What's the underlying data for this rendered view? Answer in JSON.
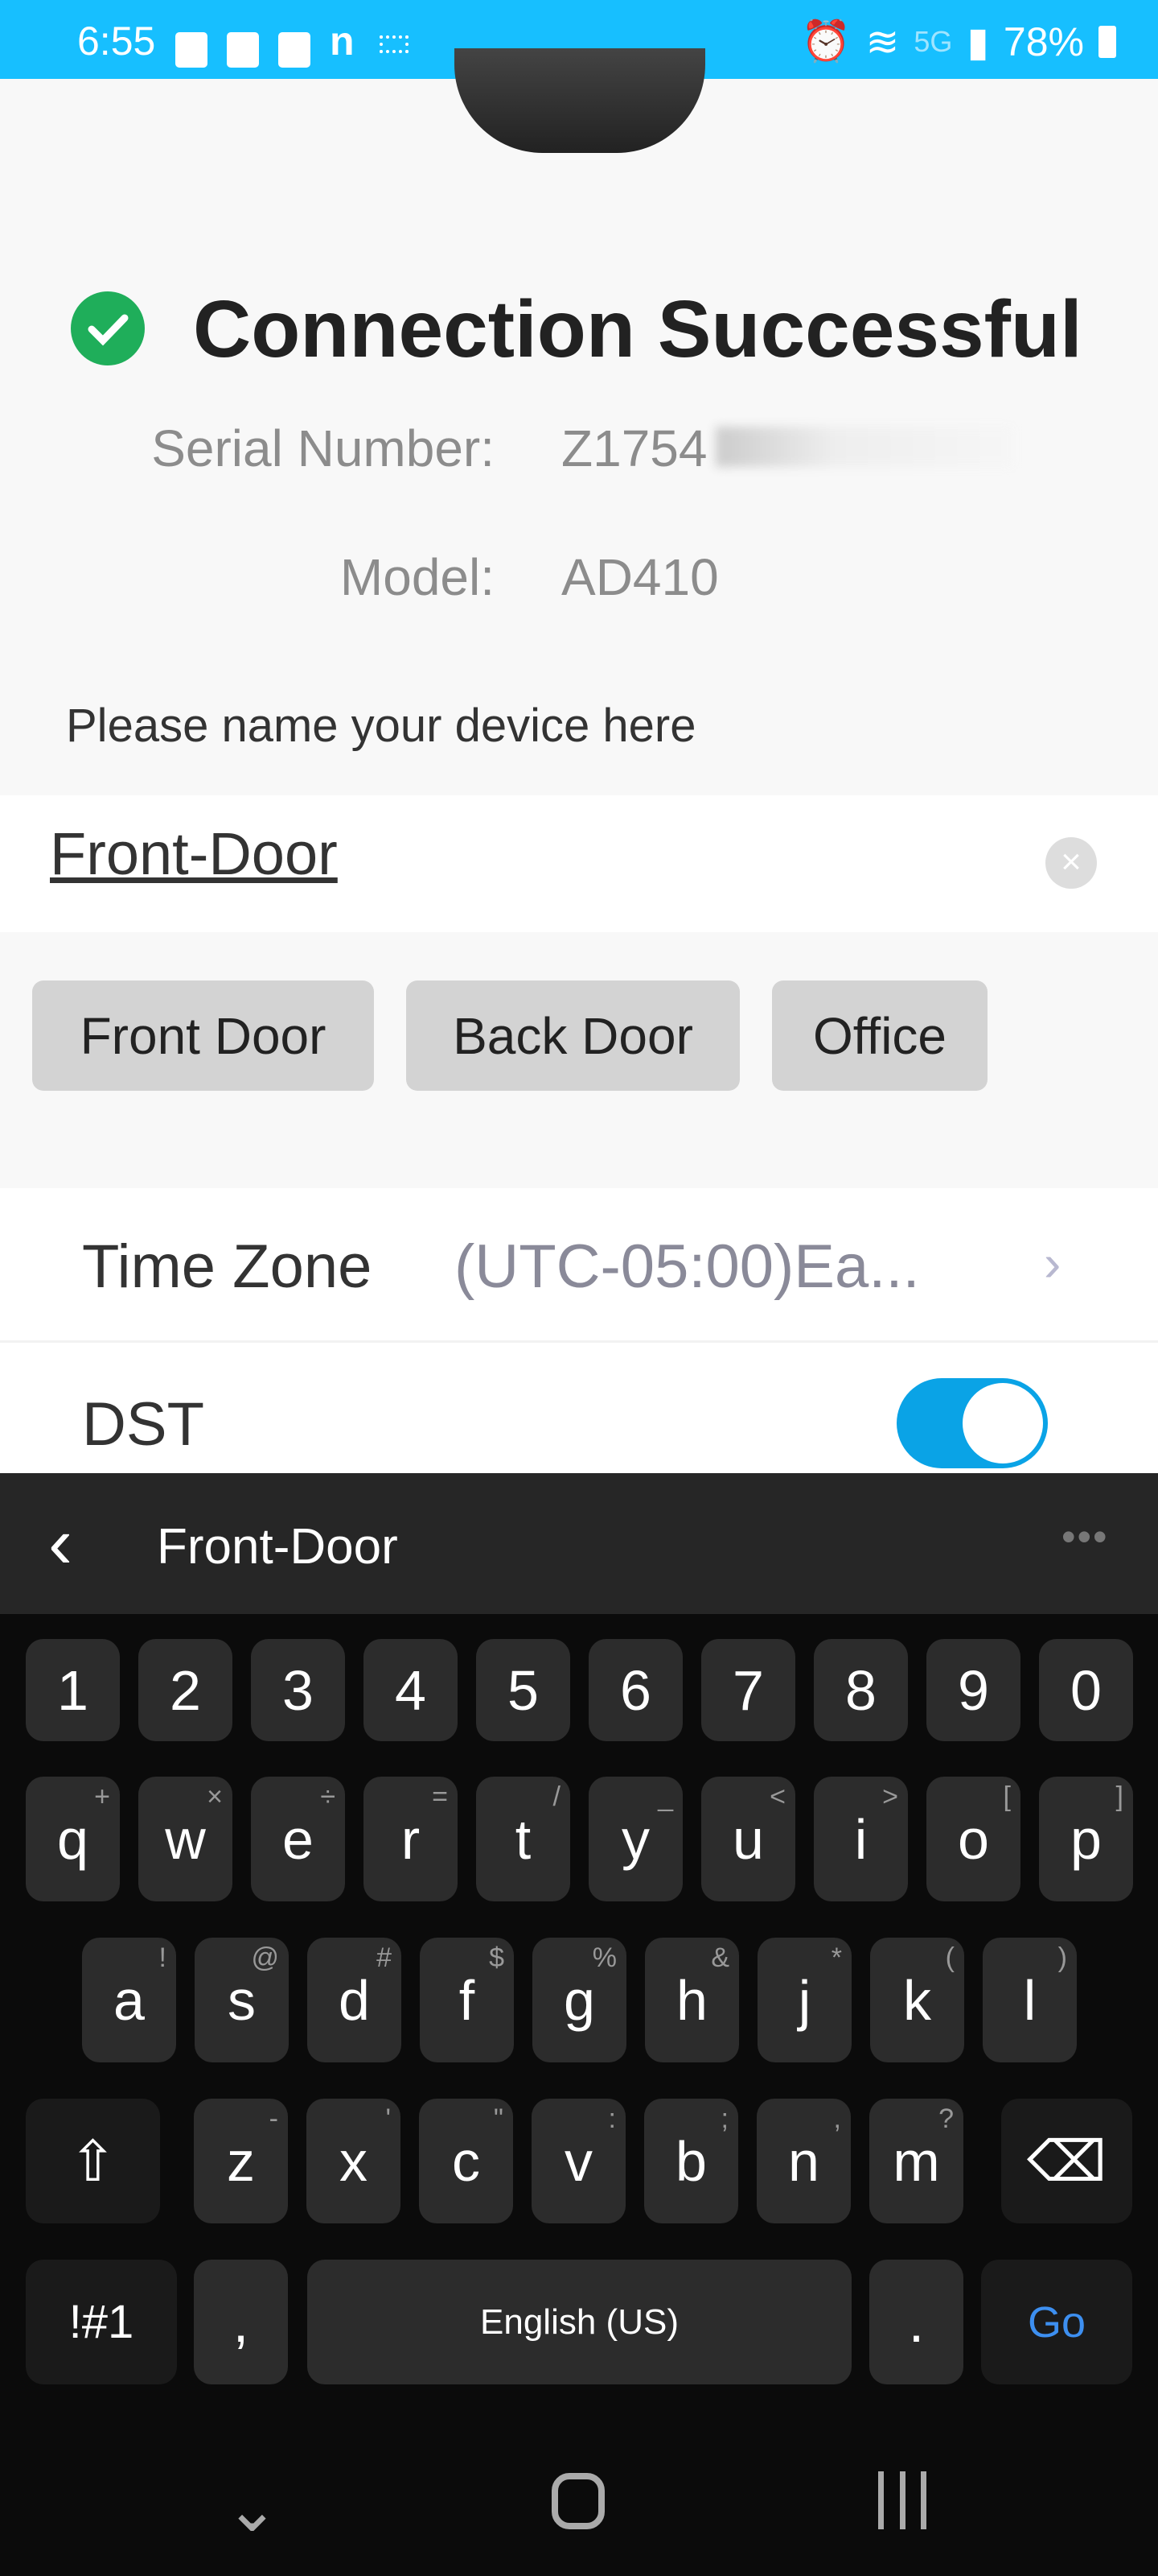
{
  "status_bar": {
    "time": "6:55",
    "network": "5G",
    "battery": "78%",
    "bg": "#17bfff"
  },
  "connection": {
    "title": "Connection Successful",
    "serial_label": "Serial Number:",
    "serial_value": "Z1754",
    "model_label": "Model:",
    "model_value": "AD410"
  },
  "naming": {
    "prompt": "Please name your device here",
    "value": "Front-Door",
    "suggestions": [
      "Front Door",
      "Back Door",
      "Office"
    ]
  },
  "settings": {
    "time_zone_label": "Time Zone",
    "time_zone_value": "(UTC-05:00)Ea...",
    "dst_label": "DST",
    "dst_on": true,
    "accent": "#0aa3e6"
  },
  "keyboard": {
    "preview": "Front-Door",
    "numbers": [
      "1",
      "2",
      "3",
      "4",
      "5",
      "6",
      "7",
      "8",
      "9",
      "0"
    ],
    "row1": [
      [
        "q",
        "+"
      ],
      [
        "w",
        "×"
      ],
      [
        "e",
        "÷"
      ],
      [
        "r",
        "="
      ],
      [
        "t",
        "/"
      ],
      [
        "y",
        "_"
      ],
      [
        "u",
        "<"
      ],
      [
        "i",
        ">"
      ],
      [
        "o",
        "["
      ],
      [
        "p",
        "]"
      ]
    ],
    "row2": [
      [
        "a",
        "!"
      ],
      [
        "s",
        "@"
      ],
      [
        "d",
        "#"
      ],
      [
        "f",
        "$"
      ],
      [
        "g",
        "%"
      ],
      [
        "h",
        "&"
      ],
      [
        "j",
        "*"
      ],
      [
        "k",
        "("
      ],
      [
        "l",
        ")"
      ]
    ],
    "row3": [
      [
        "z",
        "-"
      ],
      [
        "x",
        "'"
      ],
      [
        "c",
        "\""
      ],
      [
        "v",
        ":"
      ],
      [
        "b",
        ";"
      ],
      [
        "n",
        ","
      ],
      [
        "m",
        "?"
      ]
    ],
    "symbols": "!#1",
    "comma": ",",
    "space": "English (US)",
    "period": ".",
    "go": "Go",
    "go_color": "#3d8ff0"
  }
}
